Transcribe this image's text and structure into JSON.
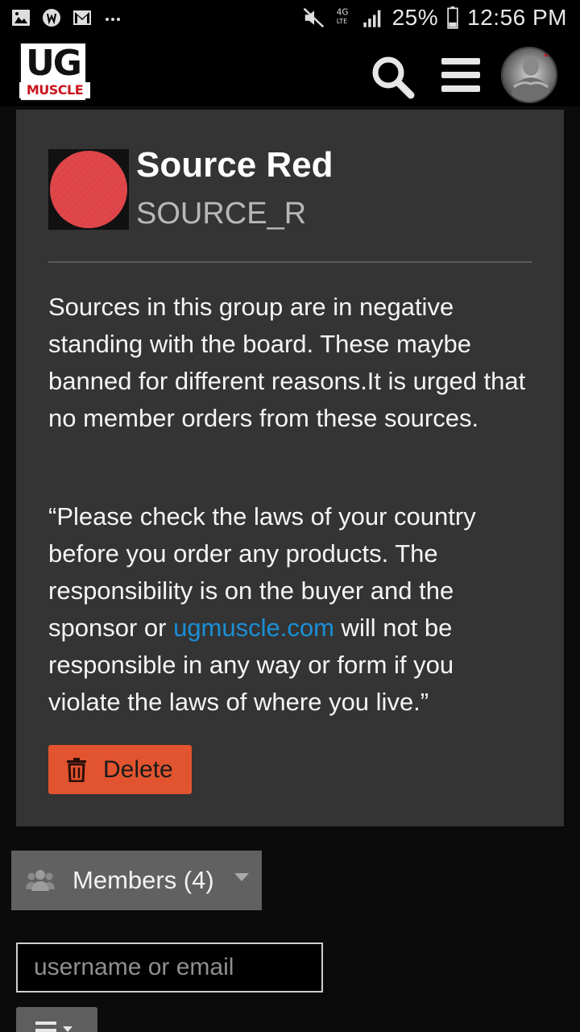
{
  "status_bar": {
    "signal_label": "4G",
    "battery": "25%",
    "time": "12:56 PM"
  },
  "header": {
    "logo_top": "UG",
    "logo_bottom": "MUSCLE"
  },
  "group": {
    "name": "Source Red",
    "code": "SOURCE_R",
    "icon_color": "#e0474b",
    "description": "Sources in this group are in negative standing with the board. These maybe banned for different reasons.It is urged that no member orders from these sources.",
    "disclaimer_before": "“Please check the laws of your country before you order any products. The responsibility is on the buyer and the sponsor or ",
    "disclaimer_link": "ugmuscle.com",
    "disclaimer_after": " will not be responsible in any way or form if you violate the laws of where you live.”",
    "delete_label": "Delete"
  },
  "members": {
    "label": "Members (4)"
  },
  "search": {
    "placeholder": "username or email"
  },
  "colors": {
    "accent_link": "#1a8fd6",
    "delete_bg": "#e2542f",
    "card_bg": "#343434"
  }
}
